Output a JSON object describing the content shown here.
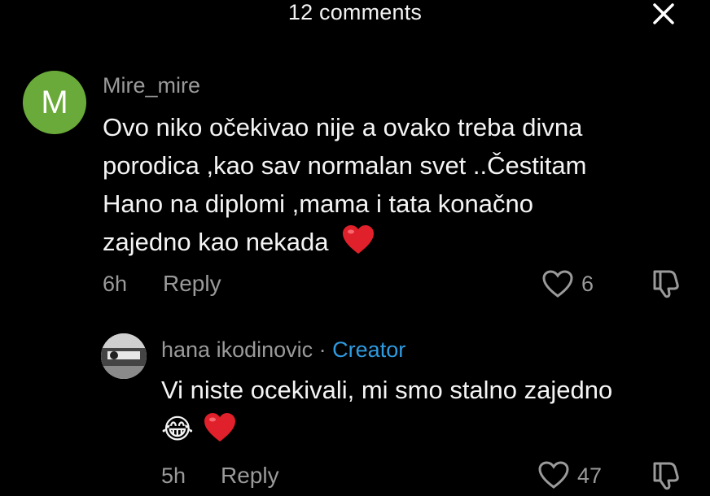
{
  "header": {
    "title": "12 comments",
    "close_icon": "close-icon"
  },
  "comments": [
    {
      "avatar_letter": "M",
      "avatar_color": "#6aaa3a",
      "username": "Mire_mire",
      "lines": [
        "Ovo niko očekivao nije a ovako treba divna",
        "porodica ,kao sav normalan svet ..Čestitam",
        "Hano na diplomi ,mama i tata konačno",
        "zajedno kao nekada"
      ],
      "emoji_end": "❤️",
      "time": "6h",
      "reply_label": "Reply",
      "likes": "6"
    },
    {
      "username": "hana ikodinovic",
      "separator": "·",
      "badge": "Creator",
      "badge_color": "#2f9be0",
      "lines": [
        "Vi niste ocekivali, mi smo stalno zajedno"
      ],
      "emoji_line": "😂",
      "time": "5h",
      "reply_label": "Reply",
      "likes": "47"
    }
  ]
}
